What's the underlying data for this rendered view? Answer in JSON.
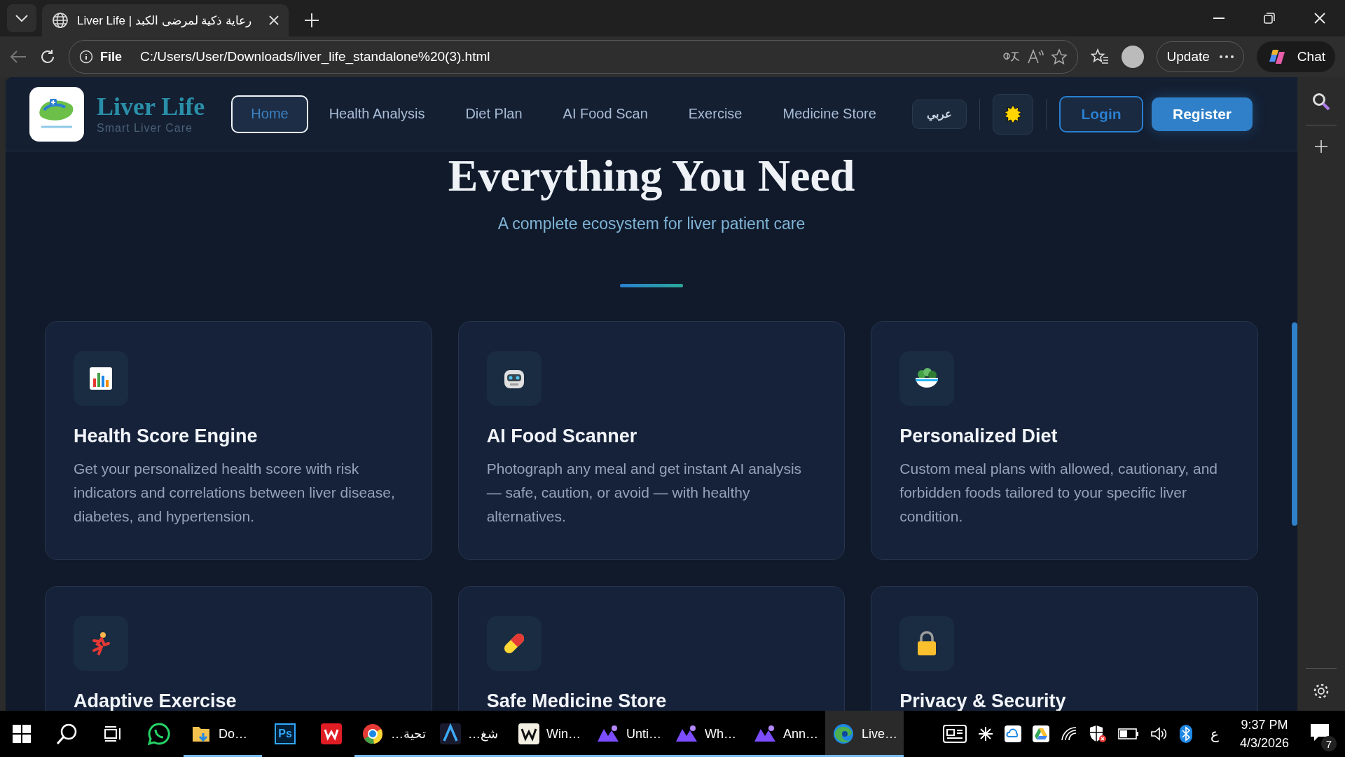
{
  "browser": {
    "tab_title": "Liver Life | رعاية ذكية لمرضى الكبد",
    "address_prefix": "File",
    "url": "C:/Users/User/Downloads/liver_life_standalone%20(3).html",
    "update_button": "Update",
    "chat_button": "Chat"
  },
  "site": {
    "brand": "Liver Life",
    "tagline": "Smart Liver Care",
    "nav": [
      {
        "label": "Home",
        "selected": true
      },
      {
        "label": "Health Analysis",
        "selected": false
      },
      {
        "label": "Diet Plan",
        "selected": false
      },
      {
        "label": "AI Food Scan",
        "selected": false
      },
      {
        "label": "Exercise",
        "selected": false
      },
      {
        "label": "Medicine Store",
        "selected": false
      }
    ],
    "language_button": "عربي",
    "login_button": "Login",
    "register_button": "Register"
  },
  "section": {
    "title": "Everything You Need",
    "subtitle": "A complete ecosystem for liver patient care"
  },
  "features": [
    {
      "kind": "chart",
      "title": "Health Score Engine",
      "description": "Get your personalized health score with risk indicators and correlations between liver disease, diabetes, and hypertension."
    },
    {
      "kind": "robot",
      "title": "AI Food Scanner",
      "description": "Photograph any meal and get instant AI analysis — safe, caution, or avoid — with healthy alternatives."
    },
    {
      "kind": "salad",
      "title": "Personalized Diet",
      "description": "Custom meal plans with allowed, cautionary, and forbidden foods tailored to your specific liver condition."
    },
    {
      "kind": "runner",
      "title": "Adaptive Exercise"
    },
    {
      "kind": "pill",
      "title": "Safe Medicine Store"
    },
    {
      "kind": "lock",
      "title": "Privacy & Security"
    }
  ],
  "taskbar": {
    "apps": [
      {
        "kind": "whatsapp",
        "running": false,
        "selected": false
      },
      {
        "kind": "folder",
        "label": "Do…",
        "running": true,
        "selected": false
      },
      {
        "kind": "photoshop",
        "badge": "Ps",
        "running": false,
        "selected": false
      },
      {
        "kind": "wps",
        "running": false,
        "selected": false
      },
      {
        "kind": "chrome",
        "label": "تحية…",
        "running": true,
        "selected": false
      },
      {
        "kind": "arc",
        "label": "شغ…",
        "running": true,
        "selected": false
      },
      {
        "kind": "w",
        "label": "Win…",
        "running": true,
        "selected": false
      },
      {
        "kind": "mountain",
        "label": "Unti…",
        "running": true,
        "selected": false
      },
      {
        "kind": "mountain",
        "label": "Wh…",
        "running": true,
        "selected": false
      },
      {
        "kind": "mountain",
        "label": "Ann…",
        "running": true,
        "selected": false
      },
      {
        "kind": "edge",
        "label": "Live…",
        "running": true,
        "selected": true
      }
    ],
    "input_language": "ع",
    "time": "9:37 PM",
    "date": "4/3/2026",
    "notification_count": "7"
  }
}
